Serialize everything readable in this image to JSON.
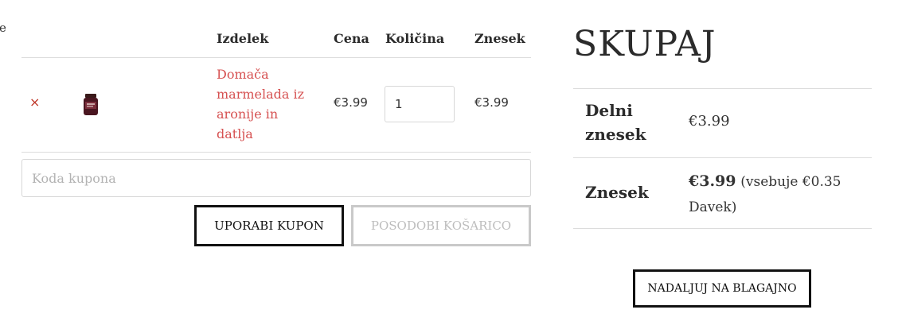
{
  "edge_char": "e",
  "cart": {
    "headers": {
      "product": "Izdelek",
      "price": "Cena",
      "quantity": "Količina",
      "subtotal": "Znesek"
    },
    "items": [
      {
        "remove": "×",
        "name": "Domača marmelada iz aronije in datlja",
        "price": "€3.99",
        "quantity": "1",
        "subtotal": "€3.99",
        "thumbnail_icon": "jam-jar-icon"
      }
    ],
    "coupon_placeholder": "Koda kupona",
    "apply_coupon": "UPORABI KUPON",
    "update_cart": "POSODOBI KOŠARICO"
  },
  "totals": {
    "title": "SKUPAJ",
    "subtotal_label": "Delni znesek",
    "subtotal_value": "€3.99",
    "total_label": "Znesek",
    "total_value": "€3.99",
    "tax_note": "(vsebuje €0.35 Davek)",
    "checkout": "NADALJUJ NA BLAGAJNO"
  },
  "colors": {
    "accent_link": "#d65151",
    "remove": "#c0392b",
    "border": "#dcdcdc"
  }
}
